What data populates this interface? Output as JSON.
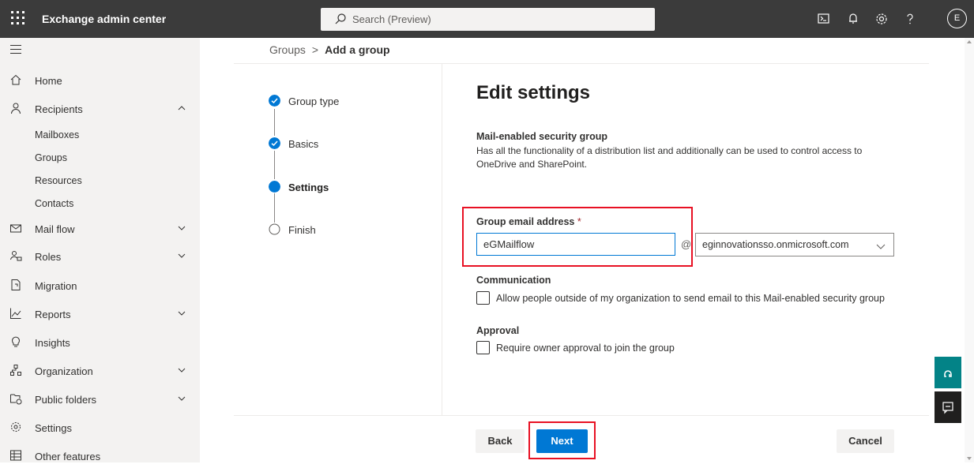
{
  "topbar": {
    "title": "Exchange admin center",
    "search_placeholder": "Search (Preview)",
    "avatar_initial": "E",
    "bg_color": "#3b3b3b"
  },
  "sidebar": {
    "items": [
      {
        "label": "Home",
        "icon": "home-icon"
      },
      {
        "label": "Recipients",
        "icon": "person-icon",
        "expanded": true
      },
      {
        "label": "Mail flow",
        "icon": "mail-icon",
        "expanded": false
      },
      {
        "label": "Roles",
        "icon": "roles-icon",
        "expanded": false
      },
      {
        "label": "Migration",
        "icon": "migration-icon"
      },
      {
        "label": "Reports",
        "icon": "reports-icon",
        "expanded": false
      },
      {
        "label": "Insights",
        "icon": "lightbulb-icon"
      },
      {
        "label": "Organization",
        "icon": "organization-icon",
        "expanded": false
      },
      {
        "label": "Public folders",
        "icon": "public-folders-icon",
        "expanded": false
      },
      {
        "label": "Settings",
        "icon": "gear-icon"
      },
      {
        "label": "Other features",
        "icon": "grid-icon"
      }
    ],
    "recipients_sub": [
      "Mailboxes",
      "Groups",
      "Resources",
      "Contacts"
    ]
  },
  "breadcrumb": {
    "root": "Groups",
    "current": "Add a group"
  },
  "wizard": {
    "steps": [
      {
        "label": "Group type",
        "state": "complete"
      },
      {
        "label": "Basics",
        "state": "complete"
      },
      {
        "label": "Settings",
        "state": "current"
      },
      {
        "label": "Finish",
        "state": "pending"
      }
    ]
  },
  "form": {
    "heading": "Edit settings",
    "group_type_title": "Mail-enabled security group",
    "group_type_desc": "Has all the functionality of a distribution list and additionally can be used to control access to OneDrive and SharePoint.",
    "email_label": "Group email address",
    "required_marker": "*",
    "email_value": "eGMailflow",
    "at_sign": "@",
    "domain_value": "eginnovationsso.onmicrosoft.com",
    "communication_title": "Communication",
    "communication_checkbox": "Allow people outside of my organization to send email to this Mail-enabled security group",
    "communication_checked": false,
    "approval_title": "Approval",
    "approval_checkbox": "Require owner approval to join the group",
    "approval_checked": false
  },
  "footer": {
    "back": "Back",
    "next": "Next",
    "cancel": "Cancel"
  },
  "colors": {
    "accent": "#0078d4",
    "highlight": "#e81123",
    "teal_tab": "#038387"
  }
}
